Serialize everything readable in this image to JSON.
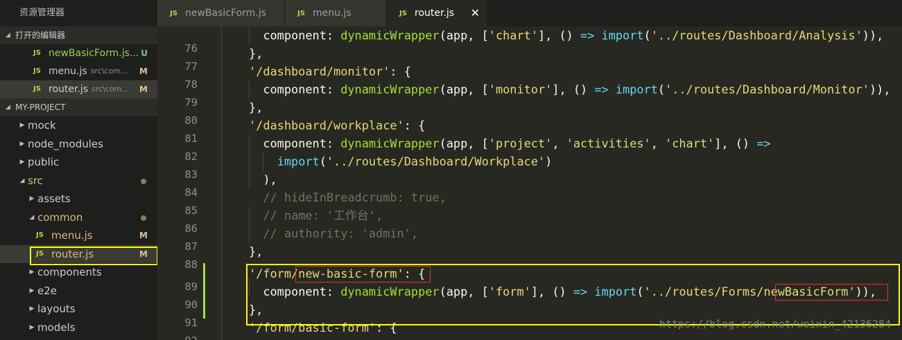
{
  "sidebar": {
    "title": "资源管理器",
    "open_editors": {
      "title": "打开的编辑器",
      "items": [
        {
          "badge": "JS",
          "name": "newBasicForm.js...",
          "path": "",
          "status": "U"
        },
        {
          "badge": "JS",
          "name": "menu.js",
          "path": "src\\com...",
          "status": "M"
        },
        {
          "badge": "JS",
          "name": "router.js",
          "path": "src\\com...",
          "status": "M"
        }
      ]
    },
    "project": {
      "title": "MY-PROJECT",
      "items": [
        {
          "label": "mock"
        },
        {
          "label": "node_modules"
        },
        {
          "label": "public"
        },
        {
          "label": "src"
        },
        {
          "label": "assets"
        },
        {
          "label": "common"
        },
        {
          "badge": "JS",
          "label": "menu.js",
          "status": "M"
        },
        {
          "badge": "JS",
          "label": "router.js",
          "status": "M"
        },
        {
          "label": "components"
        },
        {
          "label": "e2e"
        },
        {
          "label": "layouts"
        },
        {
          "label": "models"
        }
      ]
    }
  },
  "tabs": [
    {
      "badge": "JS",
      "label": "newBasicForm.js"
    },
    {
      "badge": "JS",
      "label": "menu.js"
    },
    {
      "badge": "JS",
      "label": "router.js",
      "close": "✕"
    }
  ],
  "editor": {
    "lines": [
      {
        "n": "76",
        "code": "  component: dynamicWrapper(app, ['chart'], () => import('../routes/Dashboard/Analysis')),"
      },
      {
        "n": "77",
        "code": "},"
      },
      {
        "n": "78",
        "code": "'/dashboard/monitor': {"
      },
      {
        "n": "79",
        "code": "  component: dynamicWrapper(app, ['monitor'], () => import('../routes/Dashboard/Monitor')),"
      },
      {
        "n": "80",
        "code": "},"
      },
      {
        "n": "81",
        "code": "'/dashboard/workplace': {"
      },
      {
        "n": "82",
        "code": "  component: dynamicWrapper(app, ['project', 'activities', 'chart'], () =>"
      },
      {
        "n": "83",
        "code": "    import('../routes/Dashboard/Workplace')"
      },
      {
        "n": "84",
        "code": "  ),"
      },
      {
        "n": "85",
        "code": "  // hideInBreadcrumb: true,"
      },
      {
        "n": "86",
        "code": "  // name: '工作台',"
      },
      {
        "n": "87",
        "code": "  // authority: 'admin',"
      },
      {
        "n": "88",
        "code": "},"
      },
      {
        "n": "89",
        "code": "'/form/new-basic-form': {"
      },
      {
        "n": "90",
        "code": "  component: dynamicWrapper(app, ['form'], () => import('../routes/Forms/newBasicForm')),"
      },
      {
        "n": "91",
        "code": "},"
      },
      {
        "n": "92",
        "code": "'/form/basic-form': {"
      }
    ],
    "watermark": "https://blog.csdn.net/weixin_42136284"
  },
  "colors": {
    "highlight_box": "#ffff00",
    "annotation_box": "#e0392d",
    "string": "#e6db74",
    "keyword": "#66d9ef",
    "function": "#a6e22e",
    "comment": "#75715e"
  }
}
